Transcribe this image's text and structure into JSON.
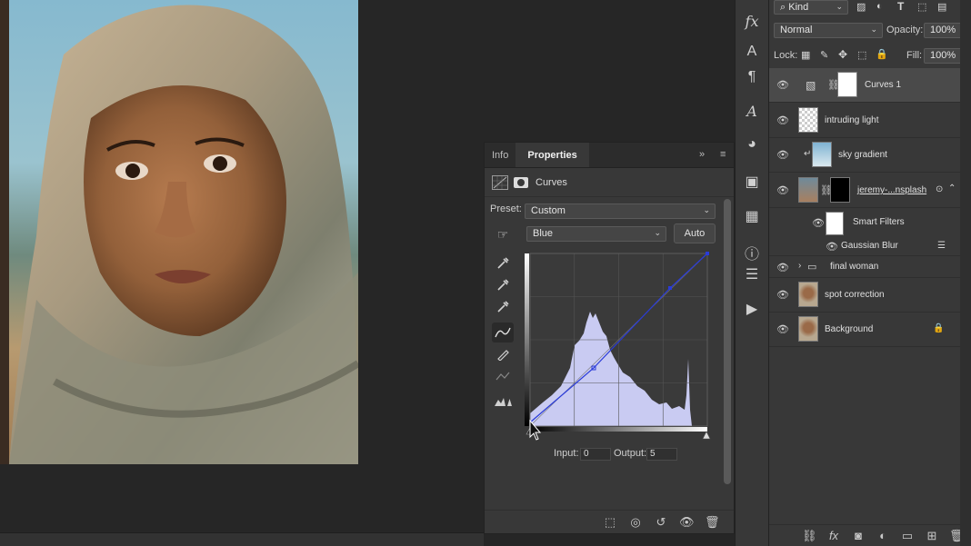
{
  "properties": {
    "tabs": [
      "Info",
      "Properties"
    ],
    "active_tab": "Properties",
    "collapse_glyph": "»",
    "menu_glyph": "≡",
    "header_title": "Curves",
    "preset_label": "Preset:",
    "preset_value": "Custom",
    "channel_value": "Blue",
    "auto_label": "Auto",
    "input_label": "Input:",
    "input_value": "0",
    "output_label": "Output:",
    "output_value": "5",
    "curve_color": "#2a3bd8",
    "histogram_color": "#c9cbf2"
  },
  "layers_panel": {
    "filter_kind": "Kind",
    "blend_mode": "Normal",
    "opacity_label": "Opacity:",
    "opacity_value": "100%",
    "lock_label": "Lock:",
    "fill_label": "Fill:",
    "fill_value": "100%",
    "layers": [
      {
        "name": "Curves 1",
        "selected": true
      },
      {
        "name": "intruding light"
      },
      {
        "name": "sky gradient"
      },
      {
        "name": "jeremy-...nsplash"
      },
      {
        "name": "Smart Filters"
      },
      {
        "name": "Gaussian Blur"
      },
      {
        "name": "final woman"
      },
      {
        "name": "spot correction"
      },
      {
        "name": "Background"
      }
    ]
  },
  "dock": {
    "icons": [
      "fx-icon",
      "character-icon",
      "paragraph-icon",
      "glyphs-icon",
      "color-wheel-icon",
      "gradient-icon",
      "table-icon",
      "info-icon",
      "adjustments-icon",
      "play-icon"
    ]
  }
}
